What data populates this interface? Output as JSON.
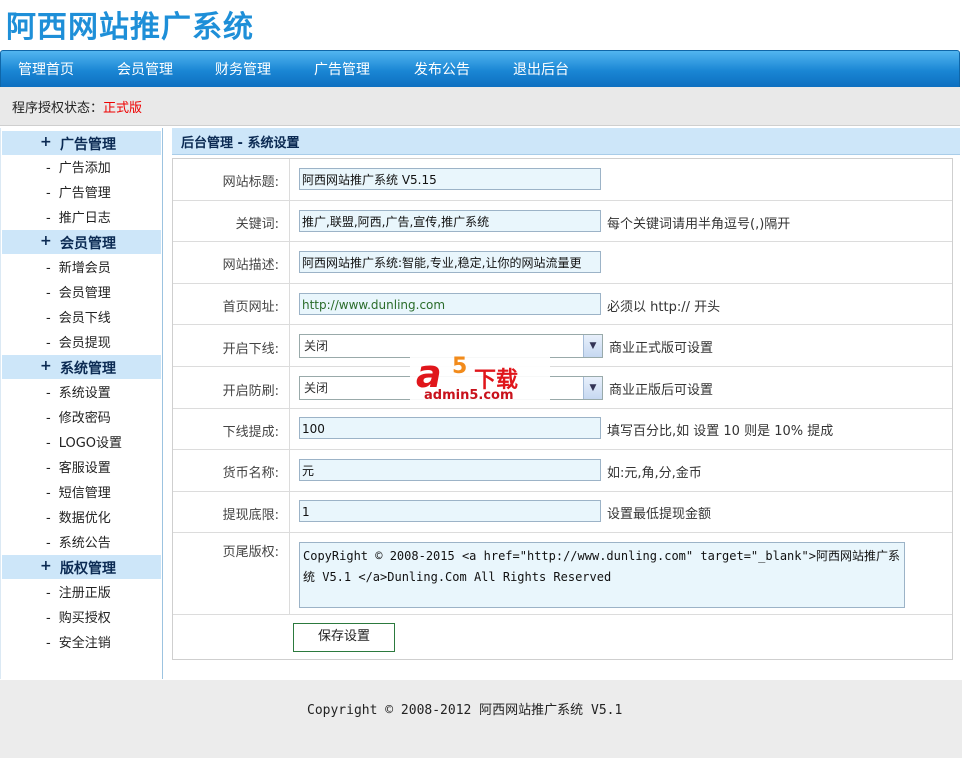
{
  "app": {
    "title": "阿西网站推广系统"
  },
  "nav": [
    "管理首页",
    "会员管理",
    "财务管理",
    "广告管理",
    "发布公告",
    "退出后台"
  ],
  "status": {
    "label": "程序授权状态：",
    "value": "正式版"
  },
  "sidebar": {
    "groups": [
      {
        "title": "广告管理",
        "items": [
          "广告添加",
          "广告管理",
          "推广日志"
        ]
      },
      {
        "title": "会员管理",
        "items": [
          "新增会员",
          "会员管理",
          "会员下线",
          "会员提现"
        ]
      },
      {
        "title": "系统管理",
        "items": [
          "系统设置",
          "修改密码",
          "LOGO设置",
          "客服设置",
          "短信管理",
          "数据优化",
          "系统公告"
        ]
      },
      {
        "title": "版权管理",
        "items": [
          "注册正版",
          "购买授权",
          "安全注销"
        ]
      }
    ]
  },
  "panel": {
    "title": "后台管理 - 系统设置"
  },
  "form": {
    "site_title": {
      "label": "网站标题:",
      "value": "阿西网站推广系统 V5.15"
    },
    "keywords": {
      "label": "关键词:",
      "value": "推广,联盟,阿西,广告,宣传,推广系统",
      "hint": "每个关键词请用半角逗号(,)隔开"
    },
    "description": {
      "label": "网站描述:",
      "value": "阿西网站推广系统:智能,专业,稳定,让你的网站流量更"
    },
    "homepage": {
      "label": "首页网址:",
      "value": "http://www.dunling.com",
      "hint": "必须以 http:// 开头"
    },
    "enable_downline": {
      "label": "开启下线:",
      "value": "关闭",
      "hint": "商业正式版可设置"
    },
    "enable_antispam": {
      "label": "开启防刷:",
      "value": "关闭",
      "hint": "商业正版后可设置"
    },
    "downline_commission": {
      "label": "下线提成:",
      "value": "100",
      "hint": "填写百分比,如 设置 10 则是 10% 提成"
    },
    "currency": {
      "label": "货币名称:",
      "value": "元",
      "hint": "如:元,角,分,金币"
    },
    "min_withdraw": {
      "label": "提现底限:",
      "value": "1",
      "hint": "设置最低提现金额"
    },
    "footer_copyright": {
      "label": "页尾版权:",
      "value": "CopyRight © 2008-2015 <a href=\"http://www.dunling.com\" target=\"_blank\">阿西网站推广系统 V5.1 </a>Dunling.Com All Rights Reserved"
    },
    "save_label": "保存设置"
  },
  "footer": {
    "text": "Copyright © 2008-2012 阿西网站推广系统 V5.1"
  },
  "watermark": {
    "a": "a",
    "five": "5",
    "download": "下载",
    "url": "admin5.com"
  },
  "colors": {
    "brand_blue": "#1e8fd8",
    "nav_blue": "#1a86d4",
    "status_red": "#e00000",
    "group_bg": "#cde6f9",
    "input_bg": "#e9f6fc"
  }
}
